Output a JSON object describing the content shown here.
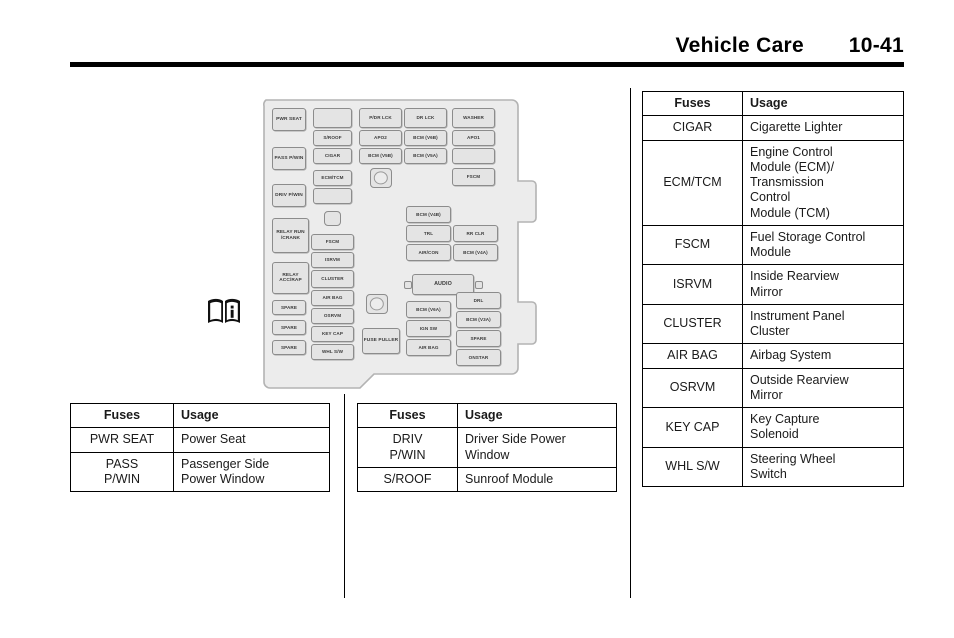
{
  "header": {
    "title": "Vehicle Care",
    "page_number": "10-41"
  },
  "figure": {
    "name": "instrument-panel-fuse-block-diagram",
    "book_icon": "open-book-info-icon",
    "fuses": [
      {
        "id": "pwr-seat",
        "label": "PWR\nSEAT"
      },
      {
        "id": "pass-pwin",
        "label": "PASS\nP/WIN"
      },
      {
        "id": "driv-pwin",
        "label": "DRIV\nP/WIN"
      },
      {
        "id": "relay-run-crank",
        "label": "RELAY\nRUN\n/CRANK"
      },
      {
        "id": "relay-acc-rap",
        "label": "RELAY\nACC/RAP"
      },
      {
        "id": "spare-l1",
        "label": "SPARE"
      },
      {
        "id": "spare-l2",
        "label": "SPARE"
      },
      {
        "id": "spare-l3",
        "label": "SPARE"
      },
      {
        "id": "blank-c1",
        "label": ""
      },
      {
        "id": "sroof",
        "label": "S/ROOF"
      },
      {
        "id": "cigar",
        "label": "CIGAR"
      },
      {
        "id": "ecm-tcm",
        "label": "ECM/TCM"
      },
      {
        "id": "blank-c2",
        "label": ""
      },
      {
        "id": "fscm-mid",
        "label": "FSCM"
      },
      {
        "id": "isrvm",
        "label": "ISRVM"
      },
      {
        "id": "cluster",
        "label": "CLUSTER"
      },
      {
        "id": "air-bag-mid",
        "label": "AIR BAG"
      },
      {
        "id": "osrvm",
        "label": "OSRVM"
      },
      {
        "id": "key-cap",
        "label": "KEY CAP"
      },
      {
        "id": "whl-sw",
        "label": "WHL S/W"
      },
      {
        "id": "fuse-puller",
        "label": "FUSE\nPULLER"
      },
      {
        "id": "pdr-lck",
        "label": "P/DR LCK"
      },
      {
        "id": "apo2",
        "label": "APO2"
      },
      {
        "id": "bcm-v5b",
        "label": "BCM (V5B)"
      },
      {
        "id": "dr-lck",
        "label": "DR LCK"
      },
      {
        "id": "bcm-v6b",
        "label": "BCM (V6B)"
      },
      {
        "id": "bcm-v5a",
        "label": "BCM (V5A)"
      },
      {
        "id": "washer",
        "label": "WASHER"
      },
      {
        "id": "apo1",
        "label": "APO1"
      },
      {
        "id": "blank-r1",
        "label": ""
      },
      {
        "id": "fscm-right",
        "label": "FSCM"
      },
      {
        "id": "bcm-v4b",
        "label": "BCM (V4B)"
      },
      {
        "id": "trl",
        "label": "TRL"
      },
      {
        "id": "air-con",
        "label": "AIR/CON"
      },
      {
        "id": "rr-clr",
        "label": "RR CLR"
      },
      {
        "id": "bcm-v4a",
        "label": "BCM (V4A)"
      },
      {
        "id": "audio",
        "label": "AUDIO"
      },
      {
        "id": "bcm-v6a",
        "label": "BCM (V6A)"
      },
      {
        "id": "ign-sw",
        "label": "IGN SW"
      },
      {
        "id": "air-bag-r",
        "label": "AIR BAG"
      },
      {
        "id": "drl",
        "label": "DRL"
      },
      {
        "id": "bcm-v3a",
        "label": "BCM (V3A)"
      },
      {
        "id": "spare-r",
        "label": "SPARE"
      },
      {
        "id": "onstar",
        "label": "ONSTAR"
      }
    ]
  },
  "tables": {
    "headers": {
      "fuses": "Fuses",
      "usage": "Usage"
    },
    "bottom_left": {
      "rows": [
        {
          "fuse": "PWR SEAT",
          "usage": "Power Seat"
        },
        {
          "fuse": "PASS\nP/WIN",
          "usage": "Passenger Side\nPower Window"
        }
      ]
    },
    "bottom_middle": {
      "rows": [
        {
          "fuse": "DRIV\nP/WIN",
          "usage": "Driver Side Power\nWindow"
        },
        {
          "fuse": "S/ROOF",
          "usage": "Sunroof Module"
        }
      ]
    },
    "right": {
      "rows": [
        {
          "fuse": "CIGAR",
          "usage": "Cigarette Lighter"
        },
        {
          "fuse": "ECM/TCM",
          "usage": "Engine Control\nModule (ECM)/\nTransmission\nControl\nModule (TCM)"
        },
        {
          "fuse": "FSCM",
          "usage": "Fuel Storage Control\nModule"
        },
        {
          "fuse": "ISRVM",
          "usage": "Inside Rearview\nMirror"
        },
        {
          "fuse": "CLUSTER",
          "usage": "Instrument Panel\nCluster"
        },
        {
          "fuse": "AIR BAG",
          "usage": "Airbag System"
        },
        {
          "fuse": "OSRVM",
          "usage": "Outside Rearview\nMirror"
        },
        {
          "fuse": "KEY CAP",
          "usage": "Key Capture\nSolenoid"
        },
        {
          "fuse": "WHL S/W",
          "usage": "Steering Wheel\nSwitch"
        }
      ]
    }
  },
  "colors": {
    "rule": "#000000",
    "fuse_fill": "#e4e4e4",
    "fuse_stroke": "#8c8c8c",
    "body_fill": "#ececec"
  }
}
